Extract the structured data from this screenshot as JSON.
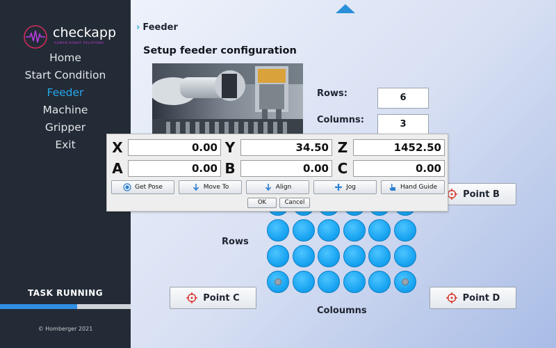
{
  "sidebar": {
    "logo": {
      "name": "checkapp",
      "tagline": "HUMAN ROBOT RELATIONS"
    },
    "nav": [
      {
        "label": "Home",
        "active": false
      },
      {
        "label": "Start Condition",
        "active": false
      },
      {
        "label": "Feeder",
        "active": true
      },
      {
        "label": "Machine",
        "active": false
      },
      {
        "label": "Gripper",
        "active": false
      },
      {
        "label": "Exit",
        "active": false
      }
    ],
    "task_status": "TASK RUNNING",
    "progress_fraction": 0.59,
    "copyright": "© Homberger 2021"
  },
  "main": {
    "breadcrumb": "Feeder",
    "title": "Setup feeder configuration",
    "rows_label": "Rows:",
    "rows_value": "6",
    "columns_label": "Columns:",
    "columns_value": "3",
    "point_b": "Point B",
    "point_c": "Point C",
    "point_d": "Point D",
    "grid_rows_label": "Rows",
    "grid_columns_label": "Coloumns"
  },
  "dialog": {
    "axes": [
      {
        "label": "X",
        "value": "0.00"
      },
      {
        "label": "Y",
        "value": "34.50"
      },
      {
        "label": "Z",
        "value": "1452.50"
      },
      {
        "label": "A",
        "value": "0.00"
      },
      {
        "label": "B",
        "value": "0.00"
      },
      {
        "label": "C",
        "value": "0.00"
      }
    ],
    "buttons": {
      "get_pose": "Get Pose",
      "move_to": "Move To",
      "align": "Align",
      "jog": "Jog",
      "hand_guide": "Hand Guide"
    },
    "ok": "OK",
    "cancel": "Cancel"
  },
  "colors": {
    "sidebar_bg": "#232b36",
    "accent": "#27a8ef",
    "grid_cell": "#1aa5f2",
    "target_red": "#d63a2f"
  },
  "icons": {
    "point": "crosshair-target-icon",
    "get_pose": "radio-target-icon",
    "move_to": "arrow-down-icon",
    "align": "arrow-down-icon",
    "jog": "four-way-arrows-icon",
    "hand_guide": "hand-pointer-icon"
  }
}
